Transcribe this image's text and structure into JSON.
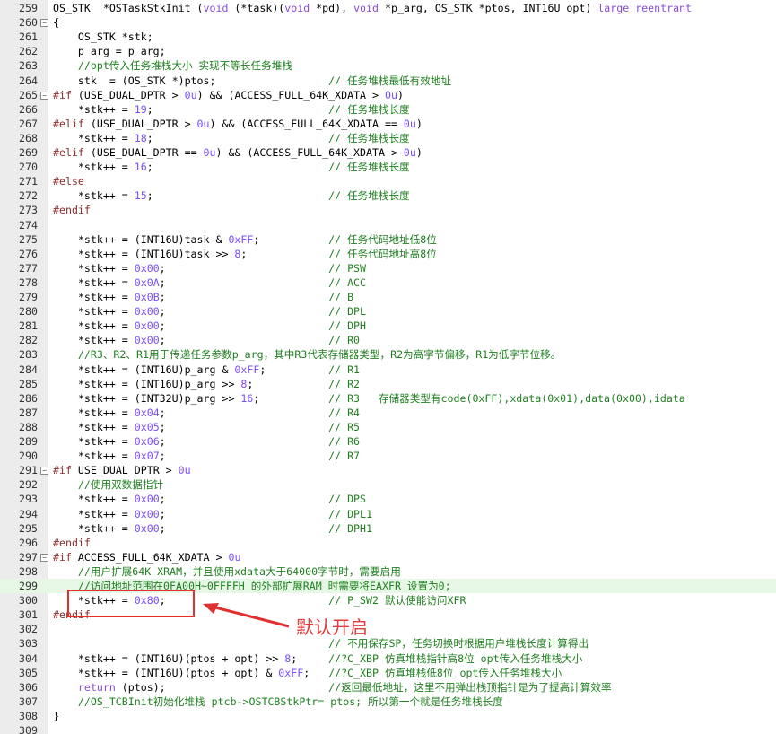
{
  "editor": {
    "lines": [
      {
        "num": "259",
        "code": "OS_STK  *OSTaskStkInit (void (*task)(void *pd), void *p_arg, OS_STK *ptos, INT16U opt) large reentrant",
        "fold": false
      },
      {
        "num": "260",
        "code": "{",
        "fold": true
      },
      {
        "num": "261",
        "code": "    OS_STK *stk;",
        "fold": false
      },
      {
        "num": "262",
        "code": "    p_arg = p_arg;",
        "fold": false
      },
      {
        "num": "263",
        "code": "    //opt传入任务堆栈大小 实现不等长任务堆栈",
        "fold": false
      },
      {
        "num": "264",
        "code": "    stk  = (OS_STK *)ptos;                  // 任务堆栈最低有效地址",
        "fold": false
      },
      {
        "num": "265",
        "code": "#if (USE_DUAL_DPTR > 0u) && (ACCESS_FULL_64K_XDATA > 0u)",
        "fold": true
      },
      {
        "num": "266",
        "code": "    *stk++ = 19;                            // 任务堆栈长度",
        "fold": false
      },
      {
        "num": "267",
        "code": "#elif (USE_DUAL_DPTR > 0u) && (ACCESS_FULL_64K_XDATA == 0u)",
        "fold": false
      },
      {
        "num": "268",
        "code": "    *stk++ = 18;                            // 任务堆栈长度",
        "fold": false
      },
      {
        "num": "269",
        "code": "#elif (USE_DUAL_DPTR == 0u) && (ACCESS_FULL_64K_XDATA > 0u)",
        "fold": false
      },
      {
        "num": "270",
        "code": "    *stk++ = 16;                            // 任务堆栈长度",
        "fold": false
      },
      {
        "num": "271",
        "code": "#else",
        "fold": false
      },
      {
        "num": "272",
        "code": "    *stk++ = 15;                            // 任务堆栈长度",
        "fold": false
      },
      {
        "num": "273",
        "code": "#endif",
        "fold": false
      },
      {
        "num": "274",
        "code": "",
        "fold": false
      },
      {
        "num": "275",
        "code": "    *stk++ = (INT16U)task & 0xFF;           // 任务代码地址低8位",
        "fold": false
      },
      {
        "num": "276",
        "code": "    *stk++ = (INT16U)task >> 8;             // 任务代码地址高8位",
        "fold": false
      },
      {
        "num": "277",
        "code": "    *stk++ = 0x00;                          // PSW",
        "fold": false
      },
      {
        "num": "278",
        "code": "    *stk++ = 0x0A;                          // ACC",
        "fold": false
      },
      {
        "num": "279",
        "code": "    *stk++ = 0x0B;                          // B",
        "fold": false
      },
      {
        "num": "280",
        "code": "    *stk++ = 0x00;                          // DPL",
        "fold": false
      },
      {
        "num": "281",
        "code": "    *stk++ = 0x00;                          // DPH",
        "fold": false
      },
      {
        "num": "282",
        "code": "    *stk++ = 0x00;                          // R0",
        "fold": false
      },
      {
        "num": "283",
        "code": "    //R3、R2、R1用于传递任务参数p_arg，其中R3代表存储器类型，R2为高字节偏移，R1为低字节位移。",
        "fold": false
      },
      {
        "num": "284",
        "code": "    *stk++ = (INT16U)p_arg & 0xFF;          // R1",
        "fold": false
      },
      {
        "num": "285",
        "code": "    *stk++ = (INT16U)p_arg >> 8;            // R2",
        "fold": false
      },
      {
        "num": "286",
        "code": "    *stk++ = (INT32U)p_arg >> 16;           // R3   存储器类型有code(0xFF),xdata(0x01),data(0x00),idata",
        "fold": false
      },
      {
        "num": "287",
        "code": "    *stk++ = 0x04;                          // R4",
        "fold": false
      },
      {
        "num": "288",
        "code": "    *stk++ = 0x05;                          // R5",
        "fold": false
      },
      {
        "num": "289",
        "code": "    *stk++ = 0x06;                          // R6",
        "fold": false
      },
      {
        "num": "290",
        "code": "    *stk++ = 0x07;                          // R7",
        "fold": false
      },
      {
        "num": "291",
        "code": "#if USE_DUAL_DPTR > 0u",
        "fold": true
      },
      {
        "num": "292",
        "code": "    //使用双数据指针",
        "fold": false
      },
      {
        "num": "293",
        "code": "    *stk++ = 0x00;                          // DPS",
        "fold": false
      },
      {
        "num": "294",
        "code": "    *stk++ = 0x00;                          // DPL1",
        "fold": false
      },
      {
        "num": "295",
        "code": "    *stk++ = 0x00;                          // DPH1",
        "fold": false
      },
      {
        "num": "296",
        "code": "#endif",
        "fold": false
      },
      {
        "num": "297",
        "code": "#if ACCESS_FULL_64K_XDATA > 0u",
        "fold": true
      },
      {
        "num": "298",
        "code": "    //用户扩展64K XRAM，并且使用xdata大于64000字节时，需要启用",
        "fold": false
      },
      {
        "num": "299",
        "code": "    //访问地址范围在0FA00H~0FFFFH 的外部扩展RAM 时需要将EAXFR 设置为0;",
        "fold": false
      },
      {
        "num": "300",
        "code": "    *stk++ = 0x80;                          // P_SW2 默认使能访问XFR",
        "fold": false
      },
      {
        "num": "301",
        "code": "#endif",
        "fold": false
      },
      {
        "num": "302",
        "code": "",
        "fold": false
      },
      {
        "num": "303",
        "code": "                                            // 不用保存SP，任务切换时根据用户堆栈长度计算得出",
        "fold": false
      },
      {
        "num": "304",
        "code": "    *stk++ = (INT16U)(ptos + opt) >> 8;     //?C_XBP 仿真堆栈指针高8位 opt传入任务堆栈大小",
        "fold": false
      },
      {
        "num": "305",
        "code": "    *stk++ = (INT16U)(ptos + opt) & 0xFF;   //?C_XBP 仿真堆栈低8位 opt传入任务堆栈大小",
        "fold": false
      },
      {
        "num": "306",
        "code": "    return (ptos);                          //返回最低地址，这里不用弹出栈顶指针是为了提高计算效率",
        "fold": false
      },
      {
        "num": "307",
        "code": "    //OS_TCBInit初始化堆栈 ptcb->OSTCBStkPtr= ptos; 所以第一个就是任务堆栈长度",
        "fold": false
      },
      {
        "num": "308",
        "code": "}",
        "fold": false
      },
      {
        "num": "309",
        "code": "",
        "fold": false
      }
    ],
    "highlight_line": "299"
  },
  "annotation": {
    "label": "默认开启",
    "color": "#e03a3a"
  }
}
